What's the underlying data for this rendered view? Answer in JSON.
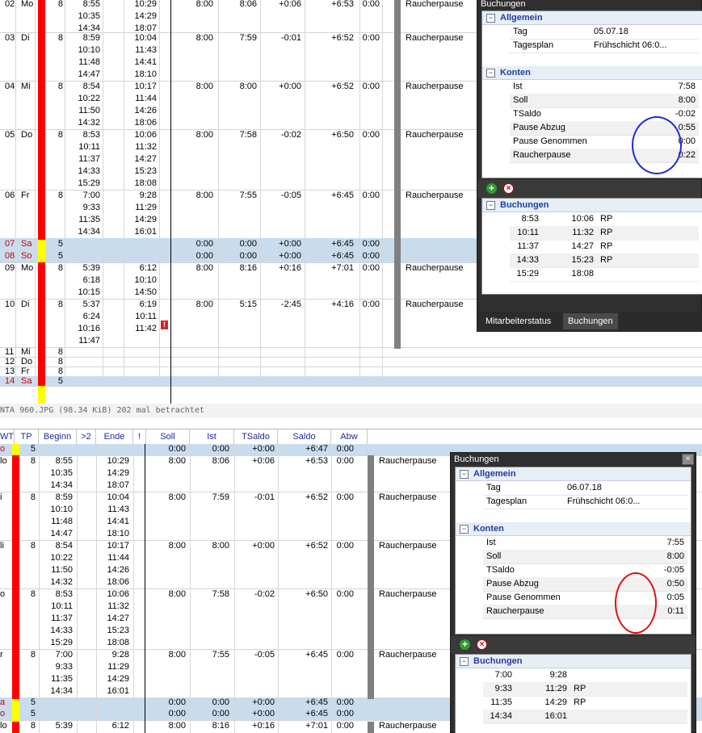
{
  "top": {
    "days": [
      {
        "tag": "02",
        "wd": "Mo",
        "tp": "8",
        "begin": "8:55\n10:35\n14:34",
        "ende": "10:29\n14:29\n18:07",
        "soll": "8:00",
        "ist": "8:06",
        "tsaldo": "+0:06",
        "saldo": "+6:53",
        "abw": "0:00",
        "note": "Raucherpause"
      },
      {
        "tag": "03",
        "wd": "Di",
        "tp": "8",
        "begin": "8:59\n10:10\n11:48\n14:47",
        "ende": "10:04\n11:43\n14:41\n18:10",
        "soll": "8:00",
        "ist": "7:59",
        "tsaldo": "-0:01",
        "saldo": "+6:52",
        "abw": "0:00",
        "note": "Raucherpause"
      },
      {
        "tag": "04",
        "wd": "Mi",
        "tp": "8",
        "begin": "8:54\n10:22\n11:50\n14:32",
        "ende": "10:17\n11:44\n14:26\n18:06",
        "soll": "8:00",
        "ist": "8:00",
        "tsaldo": "+0:00",
        "saldo": "+6:52",
        "abw": "0:00",
        "note": "Raucherpause"
      },
      {
        "tag": "05",
        "wd": "Do",
        "tp": "8",
        "begin": "8:53\n10:11\n11:37\n14:33\n15:29",
        "ende": "10:06\n11:32\n14:27\n15:23\n18:08",
        "soll": "8:00",
        "ist": "7:58",
        "tsaldo": "-0:02",
        "saldo": "+6:50",
        "abw": "0:00",
        "note": "Raucherpause"
      },
      {
        "tag": "06",
        "wd": "Fr",
        "tp": "8",
        "begin": "7:00\n9:33\n11:35\n14:34",
        "ende": "9:28\n11:29\n14:29\n16:01",
        "soll": "8:00",
        "ist": "7:55",
        "tsaldo": "-0:05",
        "saldo": "+6:45",
        "abw": "0:00",
        "note": "Raucherpause"
      },
      {
        "tag": "07",
        "wd": "Sa",
        "tp": "5",
        "begin": "",
        "ende": "",
        "soll": "0:00",
        "ist": "0:00",
        "tsaldo": "+0:00",
        "saldo": "+6:45",
        "abw": "0:00",
        "note": ""
      },
      {
        "tag": "08",
        "wd": "So",
        "tp": "5",
        "begin": "",
        "ende": "",
        "soll": "0:00",
        "ist": "0:00",
        "tsaldo": "+0:00",
        "saldo": "+6:45",
        "abw": "0:00",
        "note": ""
      },
      {
        "tag": "09",
        "wd": "Mo",
        "tp": "8",
        "begin": "5:39\n6:18\n10:15",
        "ende": "6:12\n10:10\n14:50",
        "soll": "8:00",
        "ist": "8:16",
        "tsaldo": "+0:16",
        "saldo": "+7:01",
        "abw": "0:00",
        "note": "Raucherpause"
      },
      {
        "tag": "10",
        "wd": "Di",
        "tp": "8",
        "begin": "5:37\n6:24\n10:16\n11:47",
        "ende": "6:19\n10:11\n11:42",
        "soll": "8:00",
        "ist": "5:15",
        "tsaldo": "-2:45",
        "saldo": "+4:16",
        "abw": "0:00",
        "note": "Raucherpause"
      },
      {
        "tag": "11",
        "wd": "Mi",
        "tp": "8",
        "begin": "",
        "ende": "",
        "soll": "",
        "ist": "",
        "tsaldo": "",
        "saldo": "",
        "abw": "",
        "note": ""
      },
      {
        "tag": "12",
        "wd": "Do",
        "tp": "8",
        "begin": "",
        "ende": "",
        "soll": "",
        "ist": "",
        "tsaldo": "",
        "saldo": "",
        "abw": "",
        "note": ""
      },
      {
        "tag": "13",
        "wd": "Fr",
        "tp": "8",
        "begin": "",
        "ende": "",
        "soll": "",
        "ist": "",
        "tsaldo": "",
        "saldo": "",
        "abw": "",
        "note": ""
      },
      {
        "tag": "14",
        "wd": "Sa",
        "tp": "5",
        "begin": "",
        "ende": "",
        "soll": "",
        "ist": "",
        "tsaldo": "",
        "saldo": "",
        "abw": "",
        "note": ""
      }
    ],
    "panel": {
      "title": "Buchungen",
      "sec_allgemein": "Allgemein",
      "tag_label": "Tag",
      "tag_value": "05.07.18",
      "plan_label": "Tagesplan",
      "plan_value": "Frühschicht 06:0...",
      "sec_konten": "Konten",
      "ist_label": "Ist",
      "ist_value": "7:58",
      "soll_label": "Soll",
      "soll_value": "8:00",
      "tsaldo_label": "TSaldo",
      "tsaldo_value": "-0:02",
      "pa_label": "Pause Abzug",
      "pa_value": "0:55",
      "pg_label": "Pause Genommen",
      "pg_value": "0:00",
      "rp_label": "Raucherpause",
      "rp_value": "0:22",
      "sec_buchungen": "Buchungen",
      "bookings": [
        {
          "in": "8:53",
          "out": "10:06",
          "flag": "RP"
        },
        {
          "in": "10:11",
          "out": "11:32",
          "flag": "RP"
        },
        {
          "in": "11:37",
          "out": "14:27",
          "flag": "RP"
        },
        {
          "in": "14:33",
          "out": "15:23",
          "flag": "RP"
        },
        {
          "in": "15:29",
          "out": "18:08",
          "flag": ""
        }
      ],
      "tab1": "Mitarbeiterstatus",
      "tab2": "Buchungen"
    }
  },
  "caption": "NTA 960.JPG (98.34 KiB) 202 mal betrachtet",
  "bottom": {
    "headers": {
      "wt": "WT",
      "tp": "TP",
      "beginn": "Beginn",
      "gt2": ">2",
      "ende": "Ende",
      "excl": "!",
      "soll": "Soll",
      "ist": "Ist",
      "tsaldo": "TSaldo",
      "saldo": "Saldo",
      "abw": "Abw"
    },
    "days": [
      {
        "wd": "o",
        "tp": "5",
        "begin": "",
        "ende": "",
        "soll": "0:00",
        "ist": "0:00",
        "tsaldo": "+0:00",
        "saldo": "+6:47",
        "abw": "0:00",
        "note": ""
      },
      {
        "wd": "lo",
        "tp": "8",
        "begin": "8:55\n10:35\n14:34",
        "ende": "10:29\n14:29\n18:07",
        "soll": "8:00",
        "ist": "8:06",
        "tsaldo": "+0:06",
        "saldo": "+6:53",
        "abw": "0:00",
        "note": "Raucherpause"
      },
      {
        "wd": "i",
        "tp": "8",
        "begin": "8:59\n10:10\n11:48\n14:47",
        "ende": "10:04\n11:43\n14:41\n18:10",
        "soll": "8:00",
        "ist": "7:59",
        "tsaldo": "-0:01",
        "saldo": "+6:52",
        "abw": "0:00",
        "note": "Raucherpause"
      },
      {
        "wd": "li",
        "tp": "8",
        "begin": "8:54\n10:22\n11:50\n14:32",
        "ende": "10:17\n11:44\n14:26\n18:06",
        "soll": "8:00",
        "ist": "8:00",
        "tsaldo": "+0:00",
        "saldo": "+6:52",
        "abw": "0:00",
        "note": "Raucherpause"
      },
      {
        "wd": "o",
        "tp": "8",
        "begin": "8:53\n10:11\n11:37\n14:33\n15:29",
        "ende": "10:06\n11:32\n14:27\n15:23\n18:08",
        "soll": "8:00",
        "ist": "7:58",
        "tsaldo": "-0:02",
        "saldo": "+6:50",
        "abw": "0:00",
        "note": "Raucherpause"
      },
      {
        "wd": "r",
        "tp": "8",
        "begin": "7:00\n9:33\n11:35\n14:34",
        "ende": "9:28\n11:29\n14:29\n16:01",
        "soll": "8:00",
        "ist": "7:55",
        "tsaldo": "-0:05",
        "saldo": "+6:45",
        "abw": "0:00",
        "note": "Raucherpause"
      },
      {
        "wd": "a",
        "tp": "5",
        "begin": "",
        "ende": "",
        "soll": "0:00",
        "ist": "0:00",
        "tsaldo": "+0:00",
        "saldo": "+6:45",
        "abw": "0:00",
        "note": ""
      },
      {
        "wd": "o",
        "tp": "5",
        "begin": "",
        "ende": "",
        "soll": "0:00",
        "ist": "0:00",
        "tsaldo": "+0:00",
        "saldo": "+6:45",
        "abw": "0:00",
        "note": ""
      },
      {
        "wd": "lo",
        "tp": "8",
        "begin": "5:39",
        "ende": "6:12",
        "soll": "8:00",
        "ist": "8:16",
        "tsaldo": "+0:16",
        "saldo": "+7:01",
        "abw": "0:00",
        "note": "Raucherpause"
      }
    ],
    "panel": {
      "title": "Buchungen",
      "close": "×",
      "sec_allgemein": "Allgemein",
      "tag_label": "Tag",
      "tag_value": "06.07.18",
      "plan_label": "Tagesplan",
      "plan_value": "Frühschicht 06:0...",
      "sec_konten": "Konten",
      "ist_label": "Ist",
      "ist_value": "7:55",
      "soll_label": "Soll",
      "soll_value": "8:00",
      "tsaldo_label": "TSaldo",
      "tsaldo_value": "-0:05",
      "pa_label": "Pause Abzug",
      "pa_value": "0:50",
      "pg_label": "Pause Genommen",
      "pg_value": "0:05",
      "rp_label": "Raucherpause",
      "rp_value": "0:11",
      "sec_buchungen": "Buchungen",
      "bookings": [
        {
          "in": "7:00",
          "out": "9:28",
          "flag": ""
        },
        {
          "in": "9:33",
          "out": "11:29",
          "flag": "RP"
        },
        {
          "in": "11:35",
          "out": "14:29",
          "flag": "RP"
        },
        {
          "in": "14:34",
          "out": "16:01",
          "flag": ""
        }
      ]
    }
  },
  "colors": {
    "red_bar": "#ff0000",
    "yellow_bar": "#ffff00",
    "weekend_row": "#c9dcee",
    "circle_blue": "#1a2fd0",
    "circle_red": "#e01010"
  },
  "icons": [
    "plus-icon",
    "delete-icon",
    "collapse-icon",
    "warning-icon",
    "close-icon"
  ]
}
